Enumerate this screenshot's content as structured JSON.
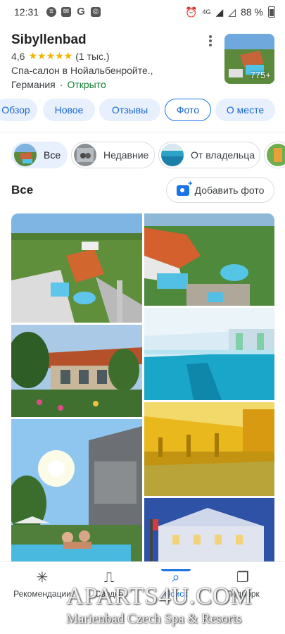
{
  "status_bar": {
    "time": "12:31",
    "signal_label": "4G",
    "battery": "88 %"
  },
  "place": {
    "name": "Sibyllenbad",
    "rating": "4,6",
    "stars": "★★★★★",
    "reviews": "(1 тыс.)",
    "description": "Спа-салон в Нойальбенройте.,",
    "country": "Германия",
    "separator": "·",
    "status": "Открыто",
    "photo_count": "775+"
  },
  "tabs": [
    {
      "label": "Обзор"
    },
    {
      "label": "Новое"
    },
    {
      "label": "Отзывы"
    },
    {
      "label": "Фото"
    },
    {
      "label": "О месте"
    }
  ],
  "filters": [
    {
      "label": "Все"
    },
    {
      "label": "Недавние"
    },
    {
      "label": "От владельца"
    }
  ],
  "section": {
    "title": "Все",
    "add_photo": "Добавить фото"
  },
  "bottom_nav": [
    {
      "label": "Рекомендации",
      "icon": "asterisk-icon"
    },
    {
      "label": "Сводка",
      "icon": "inbox-icon"
    },
    {
      "label": "Поиск",
      "icon": "search-icon"
    },
    {
      "label": "Подборк",
      "icon": "bookmarks-icon"
    }
  ],
  "watermark": {
    "line1": "APARTS4U.COM",
    "line2": "Marienbad Czech Spa & Resorts"
  },
  "colors": {
    "accent": "#1a73e8",
    "open": "#188038",
    "star": "#f4b400",
    "tab_bg": "#e8f0fe"
  }
}
